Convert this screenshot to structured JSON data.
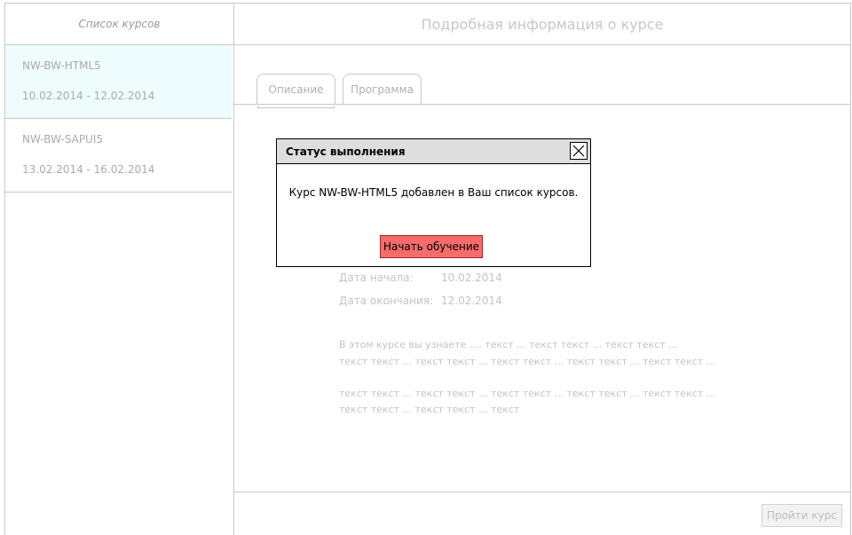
{
  "sidebar": {
    "title": "Список курсов",
    "courses": [
      {
        "name": "NW-BW-HTML5",
        "dates": "10.02.2014 - 12.02.2014",
        "selected": true
      },
      {
        "name": "NW-BW-SAPUI5",
        "dates": "13.02.2014 - 16.02.2014",
        "selected": false
      }
    ]
  },
  "main": {
    "title": "Подробная информация о курсе",
    "tabs": [
      {
        "label": "Описание",
        "active": true
      },
      {
        "label": "Программа",
        "active": false
      }
    ],
    "details": {
      "start_label": "Дата начала:",
      "start_value": "10.02.2014",
      "end_label": "Дата окончания:",
      "end_value": "12.02.2014"
    },
    "description_lines": [
      "В этом курсе вы узнаете .... текст ... текст текст ... текст текст ...",
      "текст текст ... текст текст ... текст текст ... текст текст ... текст текст ...",
      "текст текст ... текст текст ... текст текст ... текст текст ... текст текст ...",
      "текст текст ... текст текст ... текст"
    ],
    "pass_button": "Пройти курс"
  },
  "dialog": {
    "title": "Статус выполнения",
    "message": "Курс NW-BW-HTML5 добавлен в Ваш список курсов.",
    "start_button": "Начать обучение",
    "close_icon": "close-icon"
  },
  "colors": {
    "selected_course_bg": "#eefcfd",
    "start_button_bg": "#f76b6b",
    "dialog_titlebar_bg": "#dedede"
  }
}
